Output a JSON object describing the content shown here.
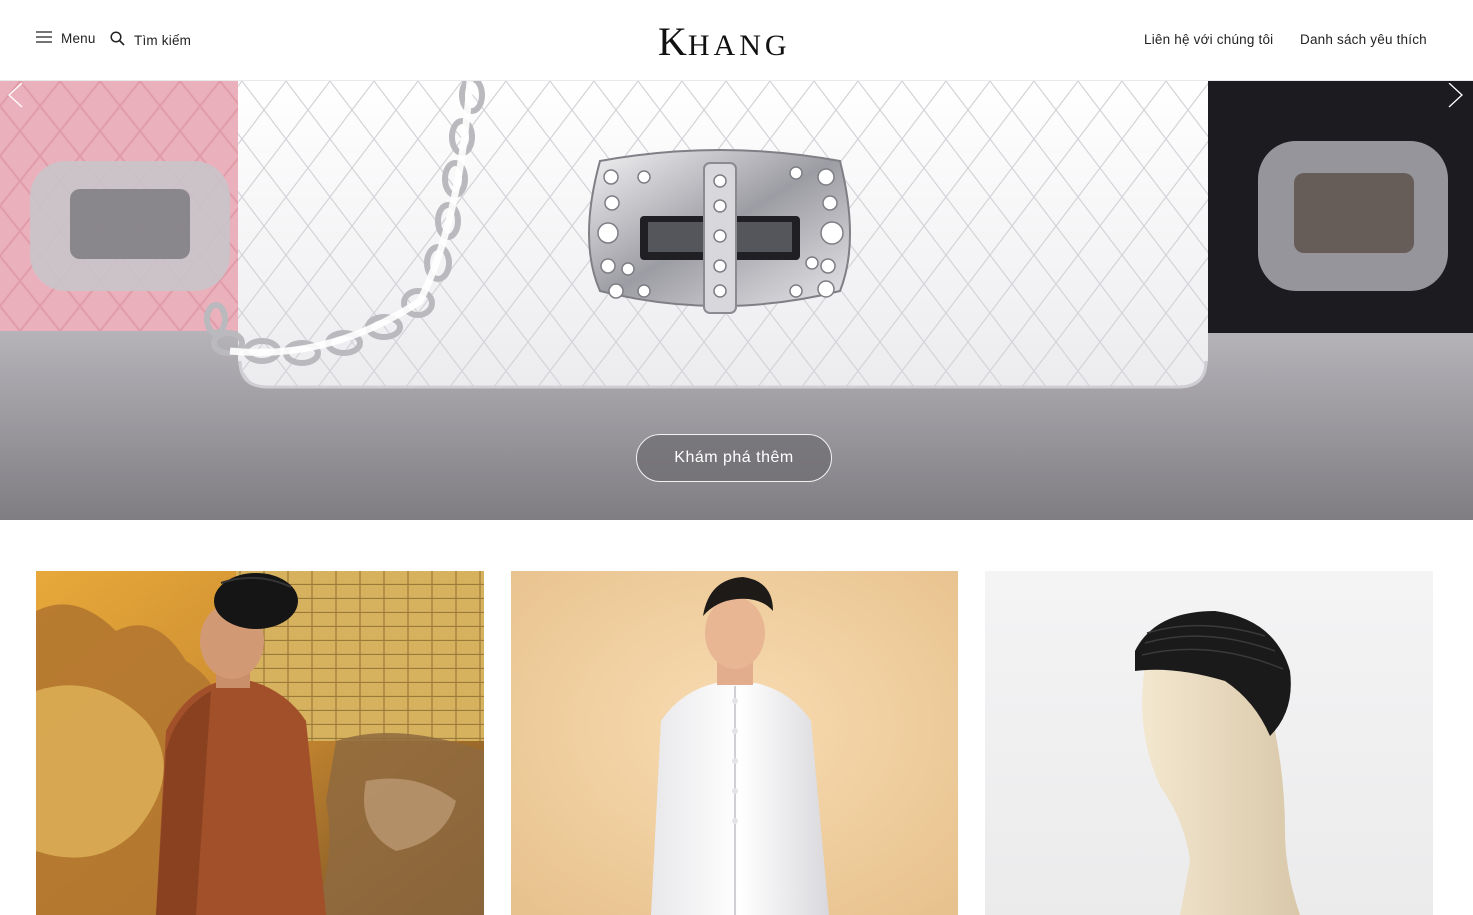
{
  "header": {
    "menu_label": "Menu",
    "search_label": "Tìm kiếm",
    "logo_first": "K",
    "logo_rest": "HANG",
    "contact_label": "Liên hệ với chúng tôi",
    "wishlist_label": "Danh sách yêu thích"
  },
  "hero": {
    "cta_label": "Khám phá thêm"
  },
  "colors": {
    "text": "#222222",
    "hero_bg": "#a8a7ab",
    "cta_bg": "#6e6c70"
  },
  "icons": {
    "menu": "hamburger-icon",
    "search": "search-icon",
    "prev": "chevron-left-icon",
    "next": "chevron-right-icon"
  }
}
